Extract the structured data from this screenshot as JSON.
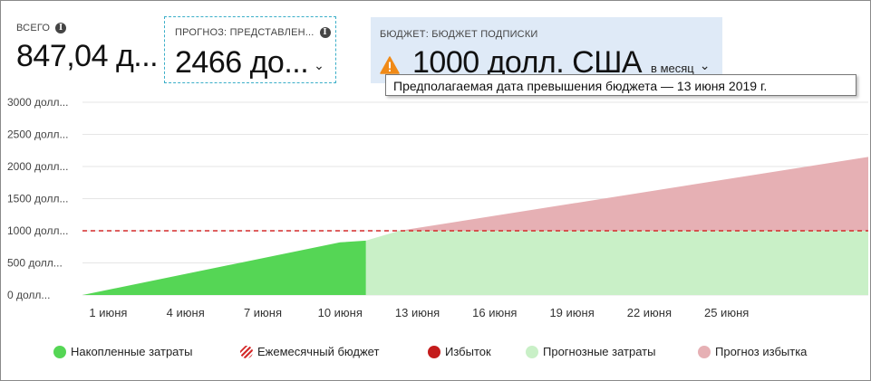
{
  "total": {
    "label": "ВСЕГО",
    "value": "847,04 д..."
  },
  "forecast": {
    "label": "ПРОГНОЗ: ПРЕДСТАВЛЕН...",
    "value": "2466 до..."
  },
  "budget": {
    "label": "БЮДЖЕТ: БЮДЖЕТ ПОДПИСКИ",
    "value": "1000 долл. США",
    "period": "в месяц"
  },
  "tooltip": {
    "text": "Предполагаемая дата превышения бюджета — 13 июня 2019 г."
  },
  "colors": {
    "accumulated": "#55d655",
    "forecast": "#c9f0c7",
    "overage": "#d42a2a",
    "overage_forecast": "#e6b0b4",
    "budget_line": "#d42a2a",
    "warning": "#f08a17"
  },
  "legend": [
    {
      "label": "Накопленные затраты",
      "key": "accumulated",
      "swatch": "#55d655"
    },
    {
      "label": "Ежемесячный бюджет",
      "key": "budget",
      "swatch": "hatch"
    },
    {
      "label": "Избыток",
      "key": "overage",
      "swatch": "#c41c1c"
    },
    {
      "label": "Прогнозные затраты",
      "key": "forecast",
      "swatch": "#c9f0c7"
    },
    {
      "label": "Прогноз избытка",
      "key": "overage_forecast",
      "swatch": "#e6b0b4"
    }
  ],
  "chart_data": {
    "type": "area",
    "title": "",
    "xlabel": "",
    "ylabel": "",
    "x_range": [
      0,
      30.5
    ],
    "ylim": [
      0,
      3000
    ],
    "y_ticks": [
      {
        "value": 0,
        "label": "0 долл..."
      },
      {
        "value": 500,
        "label": "500 долл..."
      },
      {
        "value": 1000,
        "label": "1000 долл..."
      },
      {
        "value": 1500,
        "label": "1500 долл..."
      },
      {
        "value": 2000,
        "label": "2000 долл..."
      },
      {
        "value": 2500,
        "label": "2500 долл..."
      },
      {
        "value": 3000,
        "label": "3000 долл..."
      }
    ],
    "x_ticks": [
      {
        "day": 1,
        "label": "1 июня"
      },
      {
        "day": 4,
        "label": "4 июня"
      },
      {
        "day": 7,
        "label": "7 июня"
      },
      {
        "day": 10,
        "label": "10 июня"
      },
      {
        "day": 13,
        "label": "13 июня"
      },
      {
        "day": 16,
        "label": "16 июня"
      },
      {
        "day": 19,
        "label": "19 июня"
      },
      {
        "day": 22,
        "label": "22 июня"
      },
      {
        "day": 25,
        "label": "25 июня"
      }
    ],
    "grid": true,
    "budget": 1000,
    "series": [
      {
        "name": "Накопленные затраты",
        "x": [
          0,
          10,
          11
        ],
        "y": [
          0,
          820,
          847
        ]
      },
      {
        "name": "Прогнозные затраты",
        "x": [
          11,
          12.3,
          30.5
        ],
        "y": [
          847,
          1000,
          1000
        ]
      },
      {
        "name": "Прогноз избытка",
        "x": [
          12.3,
          30.5
        ],
        "y": [
          1000,
          2150
        ]
      }
    ]
  }
}
